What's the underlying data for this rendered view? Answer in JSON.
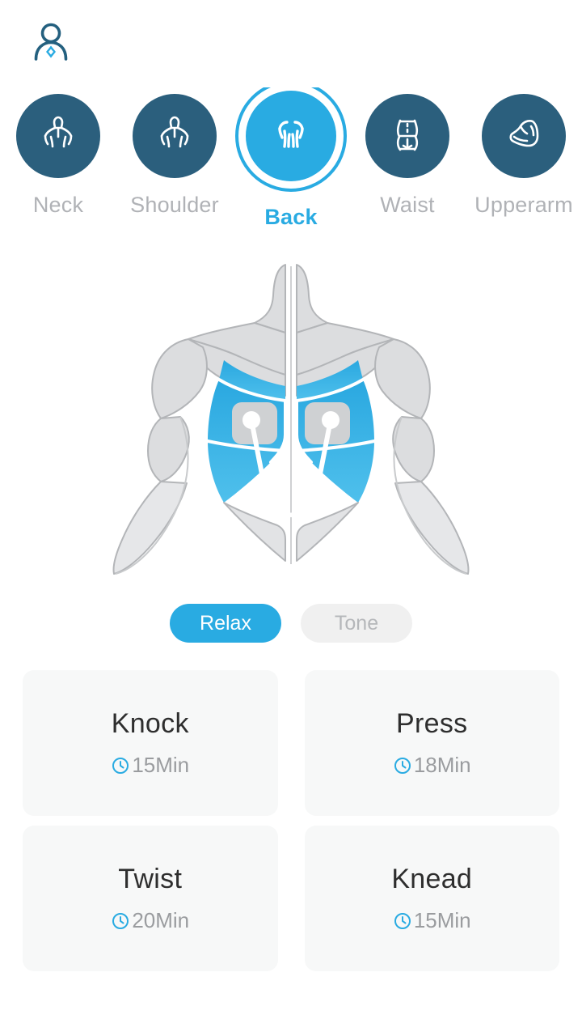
{
  "theme": {
    "accent_blue": "#29abe2",
    "dark_teal": "#2b5f7d",
    "inactive_label": "#b0b2b6",
    "card_bg": "#f7f8f8",
    "muscle_gray_fill": "#dcdddf",
    "muscle_gray_stroke": "#b3b5b8",
    "page_bg": "#ffffff"
  },
  "header": {
    "avatar_icon": "user-profile-icon"
  },
  "body_parts": {
    "selected": "Back",
    "tabs": [
      {
        "label": "Neck",
        "icon": "neck-body-icon",
        "active": false
      },
      {
        "label": "Shoulder",
        "icon": "shoulder-body-icon",
        "active": false
      },
      {
        "label": "Back",
        "icon": "back-body-icon",
        "active": true
      },
      {
        "label": "Waist",
        "icon": "waist-body-icon",
        "active": false
      },
      {
        "label": "Upperarm",
        "icon": "bicep-body-icon",
        "active": false
      }
    ]
  },
  "diagram": {
    "name": "back-muscle-diagram",
    "highlighted_region": "latissimus-dorsi",
    "electrode_pads": 2
  },
  "modes": {
    "selected": "Relax",
    "options": [
      {
        "label": "Relax",
        "active": true
      },
      {
        "label": "Tone",
        "active": false
      }
    ]
  },
  "programs": [
    {
      "title": "Knock",
      "duration": "15Min",
      "icon": "clock-icon"
    },
    {
      "title": "Press",
      "duration": "18Min",
      "icon": "clock-icon"
    },
    {
      "title": "Twist",
      "duration": "20Min",
      "icon": "clock-icon"
    },
    {
      "title": "Knead",
      "duration": "15Min",
      "icon": "clock-icon"
    }
  ]
}
